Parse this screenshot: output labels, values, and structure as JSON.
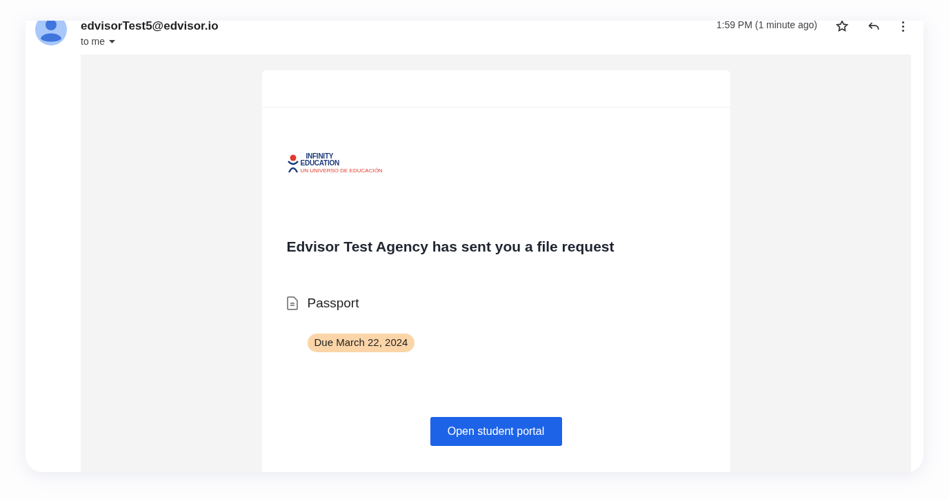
{
  "sender": {
    "address": "edvisorTest5@edvisor.io",
    "recipient": "to me"
  },
  "time": "1:59 PM (1 minute ago)",
  "email": {
    "logo": {
      "name_top": "INFINITY",
      "name_bottom": "EDUCATION",
      "tagline": "UN UNIVERSO DE EDUCACIÓN"
    },
    "heading": "Edvisor Test Agency has sent you a file request",
    "document": "Passport",
    "due": "Due March 22, 2024",
    "button": "Open student portal"
  }
}
